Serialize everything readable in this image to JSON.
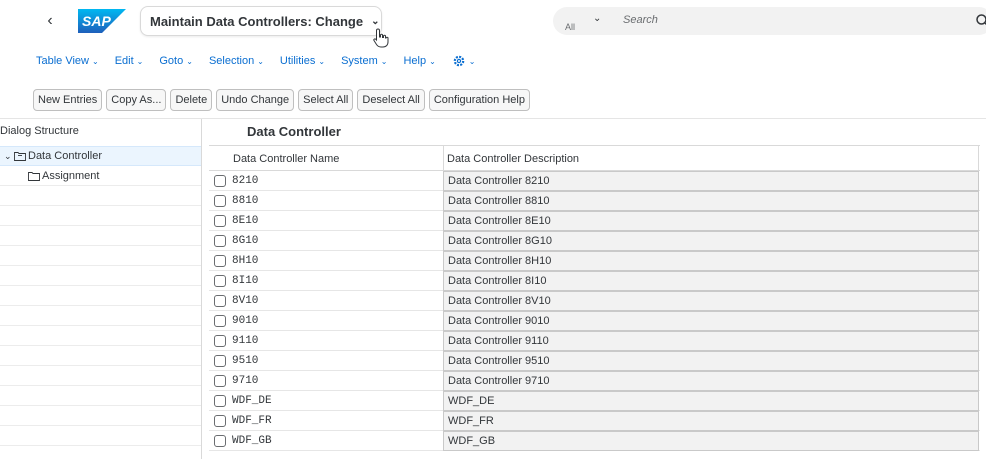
{
  "shell": {
    "title": "Maintain Data Controllers: Change",
    "logo_text": "SAP",
    "search_scope": "All",
    "search_placeholder": "Search"
  },
  "menu": [
    {
      "label": "Table View"
    },
    {
      "label": "Edit"
    },
    {
      "label": "Goto"
    },
    {
      "label": "Selection"
    },
    {
      "label": "Utilities"
    },
    {
      "label": "System"
    },
    {
      "label": "Help"
    }
  ],
  "toolbar": [
    {
      "label": "New Entries"
    },
    {
      "label": "Copy As..."
    },
    {
      "label": "Delete"
    },
    {
      "label": "Undo Change"
    },
    {
      "label": "Select All"
    },
    {
      "label": "Deselect All"
    },
    {
      "label": "Configuration Help"
    }
  ],
  "dialog_structure": {
    "title": "Dialog Structure",
    "items": [
      {
        "label": "Data Controller"
      },
      {
        "label": "Assignment"
      }
    ]
  },
  "main": {
    "title": "Data Controller",
    "columns": [
      "Data Controller Name",
      "Data Controller Description"
    ],
    "rows": [
      {
        "name": "8210",
        "description": "Data Controller 8210"
      },
      {
        "name": "8810",
        "description": "Data Controller 8810"
      },
      {
        "name": "8E10",
        "description": "Data Controller 8E10"
      },
      {
        "name": "8G10",
        "description": "Data Controller 8G10"
      },
      {
        "name": "8H10",
        "description": "Data Controller 8H10"
      },
      {
        "name": "8I10",
        "description": "Data Controller 8I10"
      },
      {
        "name": "8V10",
        "description": "Data Controller 8V10"
      },
      {
        "name": "9010",
        "description": "Data Controller 9010"
      },
      {
        "name": "9110",
        "description": "Data Controller 9110"
      },
      {
        "name": "9510",
        "description": "Data Controller 9510"
      },
      {
        "name": "9710",
        "description": "Data Controller 9710"
      },
      {
        "name": "WDF_DE",
        "description": "WDF_DE"
      },
      {
        "name": "WDF_FR",
        "description": "WDF_FR"
      },
      {
        "name": "WDF_GB",
        "description": "WDF_GB"
      }
    ]
  },
  "colors": {
    "link": "#0a6ed1",
    "sap_blue": "#0a6ed1",
    "selected_row": "#ebf5fe",
    "input_bg": "#f2f2f2"
  }
}
